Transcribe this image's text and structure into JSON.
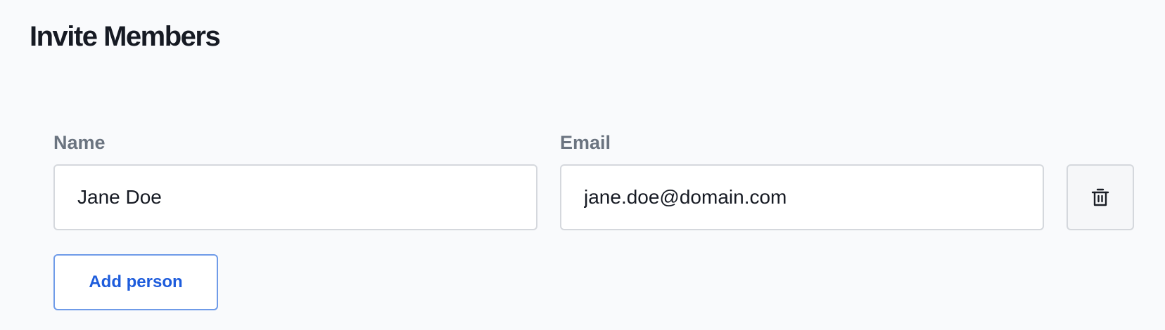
{
  "page": {
    "title": "Invite Members"
  },
  "form": {
    "name_label": "Name",
    "email_label": "Email",
    "rows": [
      {
        "name": "Jane Doe",
        "email": "jane.doe@domain.com",
        "delete_icon": "trash-icon"
      }
    ],
    "add_button_label": "Add person"
  },
  "colors": {
    "background": "#f9fafc",
    "accent": "#1d5cdc",
    "label": "#6b7480",
    "border": "#d5d8dd"
  }
}
